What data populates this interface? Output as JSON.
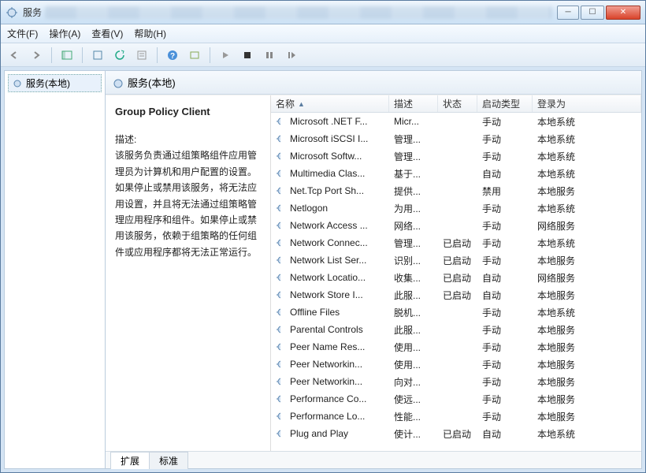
{
  "window": {
    "title": "服务"
  },
  "menus": {
    "file": "文件(F)",
    "action": "操作(A)",
    "view": "查看(V)",
    "help": "帮助(H)"
  },
  "tree": {
    "root": "服务(本地)"
  },
  "header": {
    "title": "服务(本地)"
  },
  "detail": {
    "service_name": "Group Policy Client",
    "desc_label": "描述:",
    "desc_text": "该服务负责通过组策略组件应用管理员为计算机和用户配置的设置。如果停止或禁用该服务，将无法应用设置，并且将无法通过组策略管理应用程序和组件。如果停止或禁用该服务，依赖于组策略的任何组件或应用程序都将无法正常运行。"
  },
  "columns": {
    "name": "名称",
    "desc": "描述",
    "status": "状态",
    "startup": "启动类型",
    "logon": "登录为"
  },
  "tabs": {
    "extended": "扩展",
    "standard": "标准"
  },
  "services": [
    {
      "name": "Microsoft .NET F...",
      "desc": "Micr...",
      "status": "",
      "startup": "手动",
      "logon": "本地系统"
    },
    {
      "name": "Microsoft iSCSI I...",
      "desc": "管理...",
      "status": "",
      "startup": "手动",
      "logon": "本地系统"
    },
    {
      "name": "Microsoft Softw...",
      "desc": "管理...",
      "status": "",
      "startup": "手动",
      "logon": "本地系统"
    },
    {
      "name": "Multimedia Clas...",
      "desc": "基于...",
      "status": "",
      "startup": "自动",
      "logon": "本地系统"
    },
    {
      "name": "Net.Tcp Port Sh...",
      "desc": "提供...",
      "status": "",
      "startup": "禁用",
      "logon": "本地服务"
    },
    {
      "name": "Netlogon",
      "desc": "为用...",
      "status": "",
      "startup": "手动",
      "logon": "本地系统"
    },
    {
      "name": "Network Access ...",
      "desc": "网络...",
      "status": "",
      "startup": "手动",
      "logon": "网络服务"
    },
    {
      "name": "Network Connec...",
      "desc": "管理...",
      "status": "已启动",
      "startup": "手动",
      "logon": "本地系统"
    },
    {
      "name": "Network List Ser...",
      "desc": "识别...",
      "status": "已启动",
      "startup": "手动",
      "logon": "本地服务"
    },
    {
      "name": "Network Locatio...",
      "desc": "收集...",
      "status": "已启动",
      "startup": "自动",
      "logon": "网络服务"
    },
    {
      "name": "Network Store I...",
      "desc": "此服...",
      "status": "已启动",
      "startup": "自动",
      "logon": "本地服务"
    },
    {
      "name": "Offline Files",
      "desc": "脱机...",
      "status": "",
      "startup": "手动",
      "logon": "本地系统"
    },
    {
      "name": "Parental Controls",
      "desc": "此服...",
      "status": "",
      "startup": "手动",
      "logon": "本地服务"
    },
    {
      "name": "Peer Name Res...",
      "desc": "使用...",
      "status": "",
      "startup": "手动",
      "logon": "本地服务"
    },
    {
      "name": "Peer Networkin...",
      "desc": "使用...",
      "status": "",
      "startup": "手动",
      "logon": "本地服务"
    },
    {
      "name": "Peer Networkin...",
      "desc": "向对...",
      "status": "",
      "startup": "手动",
      "logon": "本地服务"
    },
    {
      "name": "Performance Co...",
      "desc": "使远...",
      "status": "",
      "startup": "手动",
      "logon": "本地服务"
    },
    {
      "name": "Performance Lo...",
      "desc": "性能...",
      "status": "",
      "startup": "手动",
      "logon": "本地服务"
    },
    {
      "name": "Plug and Play",
      "desc": "使计...",
      "status": "已启动",
      "startup": "自动",
      "logon": "本地系统"
    }
  ]
}
